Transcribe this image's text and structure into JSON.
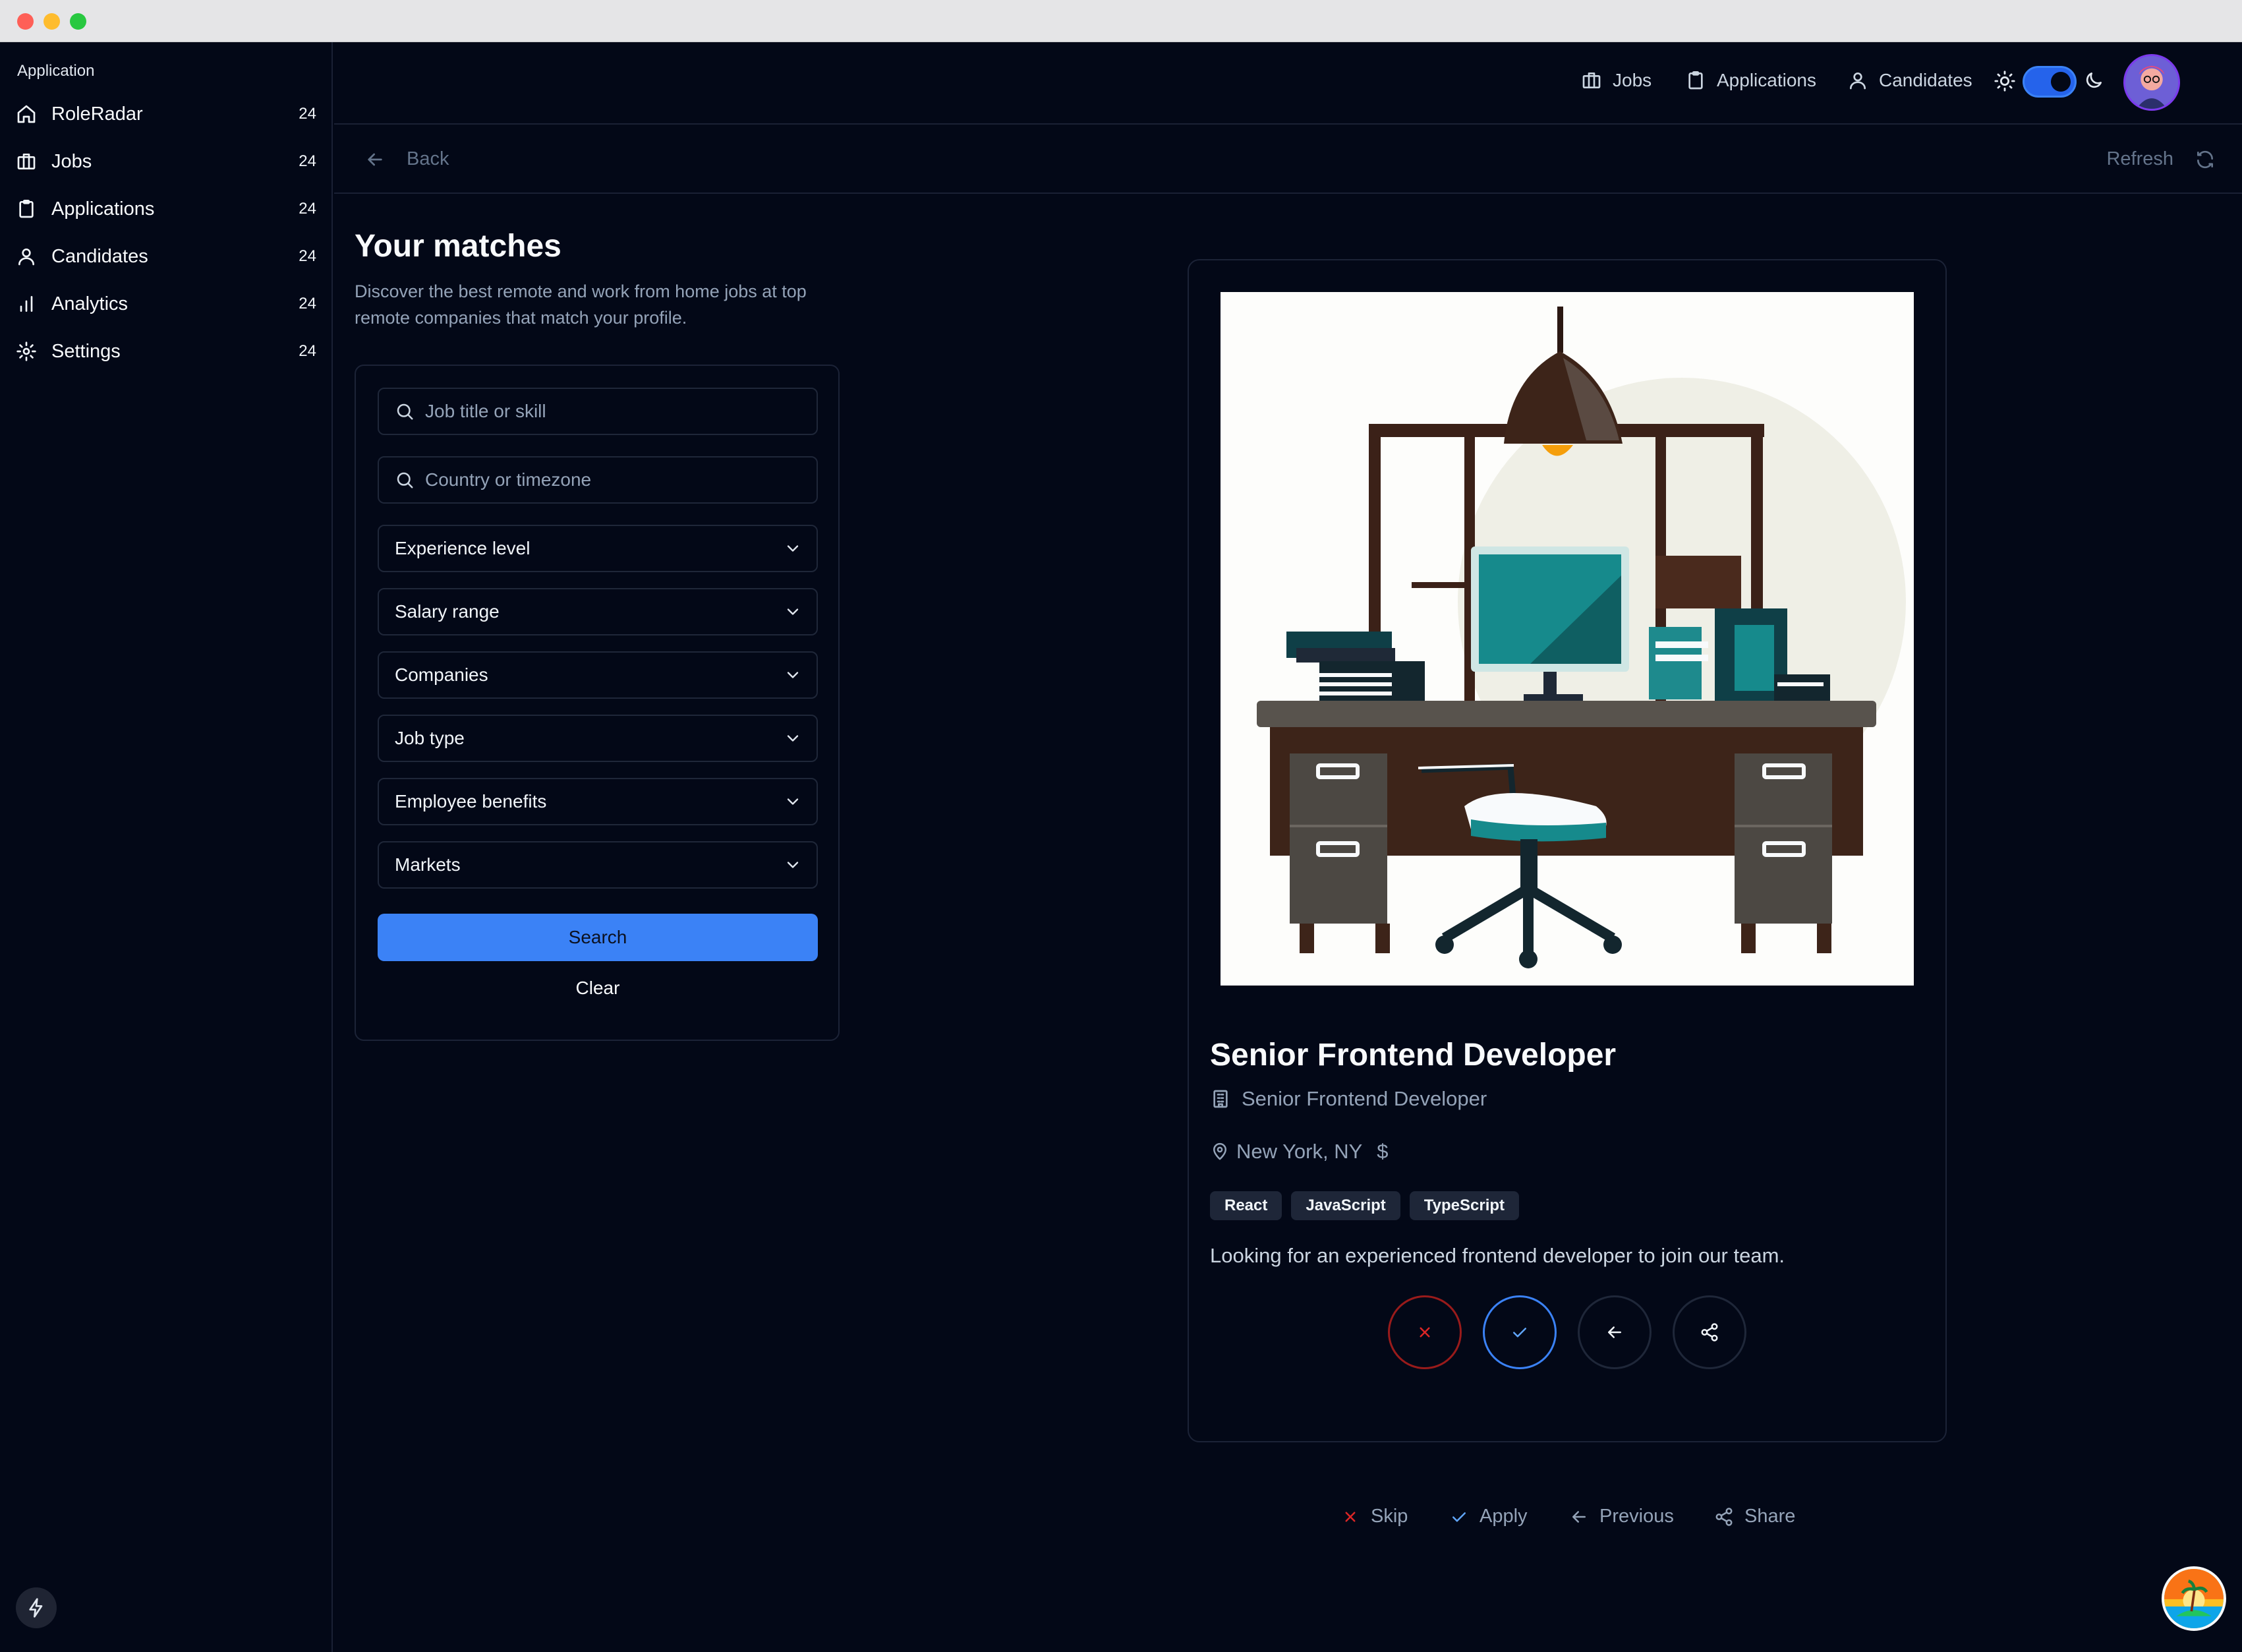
{
  "sidebar": {
    "heading": "Application",
    "items": [
      {
        "label": "RoleRadar",
        "count": "24",
        "icon": "home-icon"
      },
      {
        "label": "Jobs",
        "count": "24",
        "icon": "briefcase-icon"
      },
      {
        "label": "Applications",
        "count": "24",
        "icon": "clipboard-icon"
      },
      {
        "label": "Candidates",
        "count": "24",
        "icon": "user-icon"
      },
      {
        "label": "Analytics",
        "count": "24",
        "icon": "bar-chart-icon"
      },
      {
        "label": "Settings",
        "count": "24",
        "icon": "gear-icon"
      }
    ]
  },
  "topnav": {
    "items": [
      {
        "label": "Jobs",
        "icon": "briefcase-icon"
      },
      {
        "label": "Applications",
        "icon": "clipboard-icon"
      },
      {
        "label": "Candidates",
        "icon": "user-icon"
      }
    ],
    "theme_toggle_on": true
  },
  "subbar": {
    "back_label": "Back",
    "refresh_label": "Refresh"
  },
  "page": {
    "title": "Your matches",
    "description": "Discover the best remote and work from home jobs at top remote companies that match your profile."
  },
  "filters": {
    "search_placeholder": "Job title or skill",
    "location_placeholder": "Country or timezone",
    "selects": [
      "Experience level",
      "Salary range",
      "Companies",
      "Job type",
      "Employee benefits",
      "Markets"
    ],
    "search_label": "Search",
    "clear_label": "Clear"
  },
  "job": {
    "title": "Senior Frontend Developer",
    "company": "Senior Frontend Developer",
    "location": "New York, NY",
    "salary_symbol": "$",
    "tags": [
      "React",
      "JavaScript",
      "TypeScript"
    ],
    "description": "Looking for an experienced frontend developer to join our team."
  },
  "footer_actions": {
    "skip": "Skip",
    "apply": "Apply",
    "previous": "Previous",
    "share": "Share"
  },
  "colors": {
    "background": "#030817",
    "accent": "#3b82f6",
    "skip": "#dc2626",
    "muted": "#94a3b8"
  }
}
